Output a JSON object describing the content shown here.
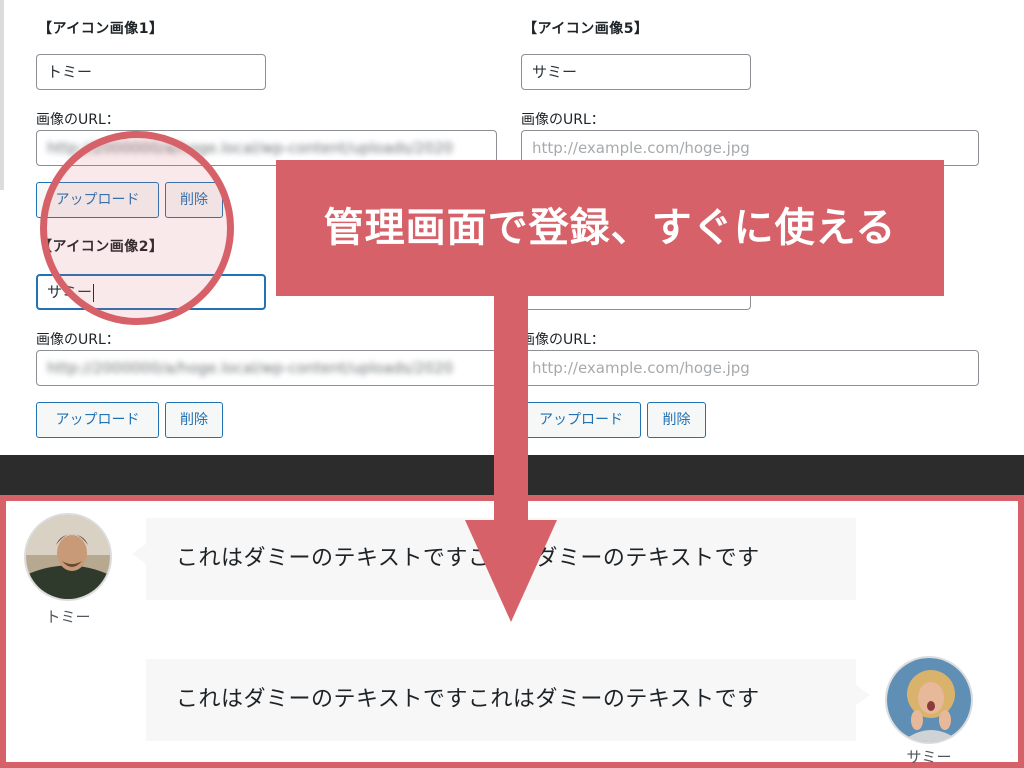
{
  "admin": {
    "left_column": {
      "icon1": {
        "heading": "【アイコン画像1】",
        "name_value": "トミー",
        "url_label": "画像のURL：",
        "url_value": "http://2000000/a/hoge.local/wp-content/uploads/2020",
        "upload_label": "アップロード",
        "delete_label": "削除"
      },
      "icon2": {
        "heading": "【アイコン画像2】",
        "name_value": "サミー",
        "url_label": "画像のURL：",
        "url_value": "http://2000000/a/hoge.local/wp-content/uploads/2020",
        "upload_label": "アップロード",
        "delete_label": "削除"
      }
    },
    "right_column": {
      "icon5": {
        "heading": "【アイコン画像5】",
        "name_value": "サミー",
        "url_label": "画像のURL：",
        "url_placeholder": "http://example.com/hoge.jpg"
      },
      "icon6": {
        "url_label": "画像のURL：",
        "url_placeholder": "http://example.com/hoge.jpg",
        "upload_label": "アップロード",
        "delete_label": "削除"
      }
    }
  },
  "banner": {
    "text": "管理画面で登録、すぐに使える"
  },
  "preview": {
    "messages": [
      {
        "speaker": "トミー",
        "text": "これはダミーのテキストですこれはダミーのテキストです",
        "side": "left"
      },
      {
        "speaker": "サミー",
        "text": "これはダミーのテキストですこれはダミーのテキストです",
        "side": "right"
      }
    ]
  },
  "colors": {
    "accent": "#d76168",
    "wp_blue": "#2271b1",
    "divider": "#2c2c2c"
  }
}
